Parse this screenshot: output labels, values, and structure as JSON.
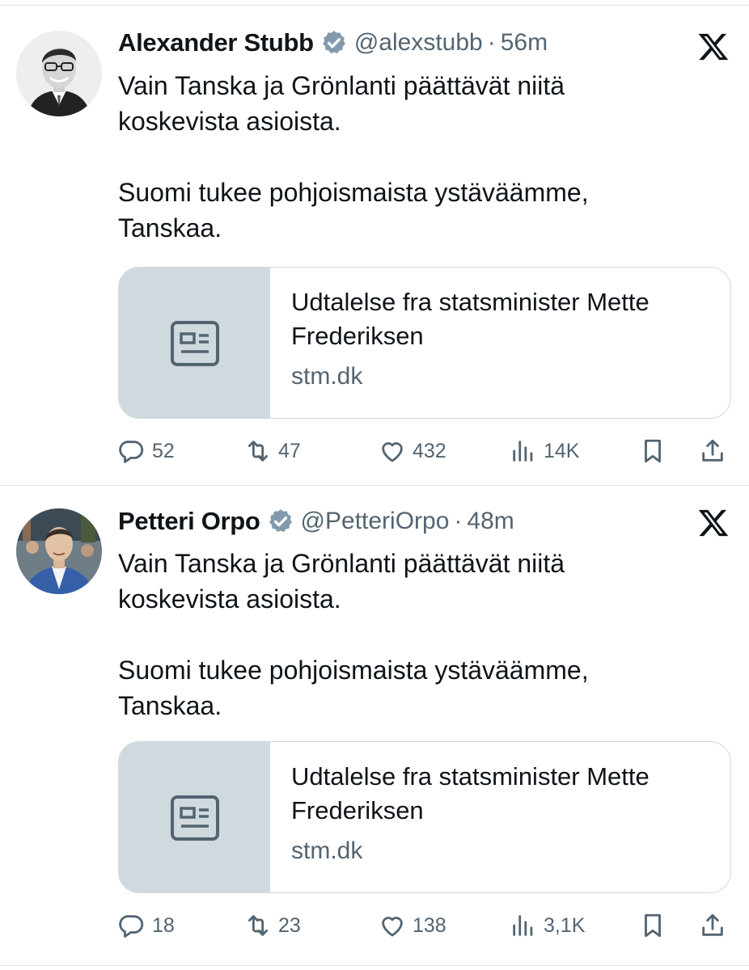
{
  "tweets": [
    {
      "name": "Alexander Stubb",
      "handle": "@alexstubb",
      "separator": "·",
      "time": "56m",
      "text": "Vain Tanska ja Grönlanti päättävät niitä\nkoskevista asioista.\n\nSuomi tukee pohjoismaista ystäväämme,\nTanskaa.",
      "card": {
        "title": "Udtalelse fra statsminister Mette Frederiksen",
        "domain": "stm.dk"
      },
      "stats": {
        "replies": "52",
        "reposts": "47",
        "likes": "432",
        "views": "14K"
      }
    },
    {
      "name": "Petteri Orpo",
      "handle": "@PetteriOrpo",
      "separator": "·",
      "time": "48m",
      "text": "Vain Tanska ja Grönlanti päättävät niitä\nkoskevista asioista.\n\nSuomi tukee pohjoismaista ystäväämme,\nTanskaa.",
      "card": {
        "title": "Udtalelse fra statsminister Mette Frederiksen",
        "domain": "stm.dk"
      },
      "stats": {
        "replies": "18",
        "reposts": "23",
        "likes": "138",
        "views": "3,1K"
      }
    }
  ],
  "icons": {
    "verified": "verified-badge-icon",
    "platform": "x-logo-icon",
    "card_placeholder": "article-icon",
    "reply": "reply-icon",
    "repost": "repost-icon",
    "like": "heart-icon",
    "views": "views-icon",
    "bookmark": "bookmark-icon",
    "share": "share-icon"
  },
  "colors": {
    "text": "#0f1419",
    "secondary": "#536471",
    "verified_badge": "#829aab",
    "card_border": "#cfd9de",
    "card_thumb": "#cfd9de",
    "divider": "#e1e6ea"
  }
}
